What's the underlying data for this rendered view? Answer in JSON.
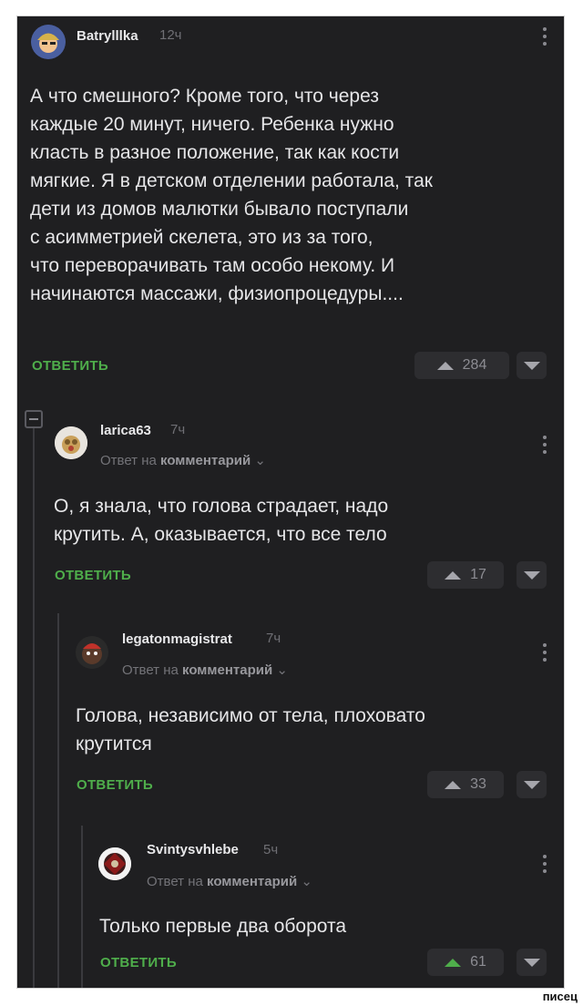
{
  "comments": [
    {
      "username": "Batrylllka",
      "time": "12ч",
      "text_lines": [
        "А что смешного? Кроме того, что через",
        "каждые 20 минут, ничего. Ребенка нужно",
        "класть в разное положение, так как кости",
        "мягкие. Я в детском отделении работала, так",
        "дети из домов малютки бывало поступали",
        "с асимметрией скелета, это из за того,",
        "что переворачивать там особо некому. И",
        "начинаются массажи, физиопроцедуры...."
      ],
      "reply_label": "ОТВЕТИТЬ",
      "votes": "284"
    },
    {
      "username": "larica63",
      "time": "7ч",
      "reply_to_prefix": "Ответ на",
      "reply_to_target": "комментарий",
      "text_lines": [
        "О, я знала, что голова страдает, надо",
        "крутить. А, оказывается, что все тело"
      ],
      "reply_label": "ОТВЕТИТЬ",
      "votes": "17"
    },
    {
      "username": "legatonmagistrat",
      "time": "7ч",
      "reply_to_prefix": "Ответ на",
      "reply_to_target": "комментарий",
      "text_lines": [
        "Голова, независимо от тела, плоховато",
        "крутится"
      ],
      "reply_label": "ОТВЕТИТЬ",
      "votes": "33"
    },
    {
      "username": "Svintysvhlebe",
      "time": "5ч",
      "reply_to_prefix": "Ответ на",
      "reply_to_target": "комментарий",
      "text_lines": [
        "Только первые два оборота"
      ],
      "reply_label": "ОТВЕТИТЬ",
      "votes": "61"
    }
  ],
  "watermark": "писец",
  "icons": {
    "kebab": "more-vertical-icon",
    "upvote": "arrow-up-icon",
    "downvote": "arrow-down-icon",
    "chevron": "chevron-down-icon",
    "collapse": "collapse-thread-icon"
  },
  "colors": {
    "background": "#1f1f21",
    "accent": "#4fae4b",
    "text": "#e6e6e8",
    "muted": "#737378"
  }
}
